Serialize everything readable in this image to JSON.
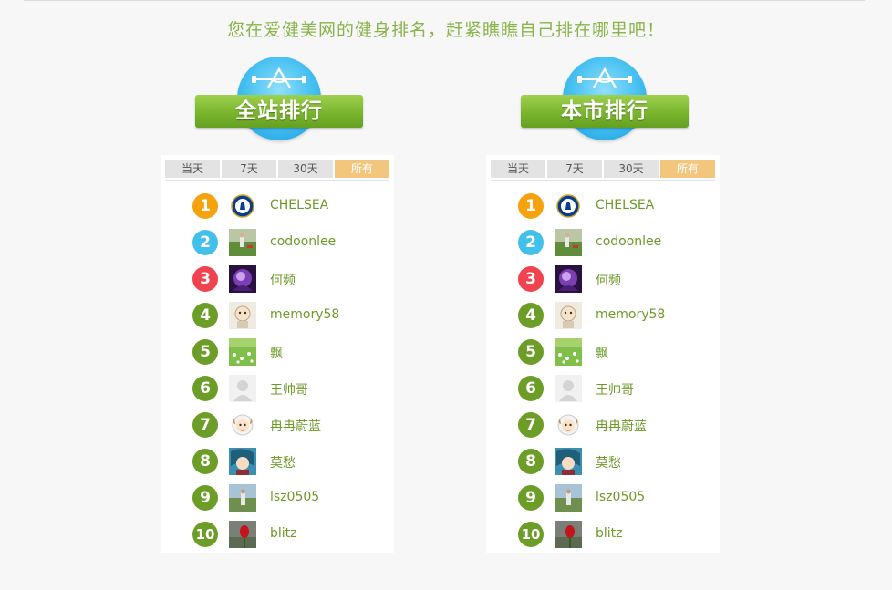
{
  "headline": "您在爱健美网的健身排名，赶紧瞧瞧自己排在哪里吧！",
  "colors": {
    "rank1": "#f5a20c",
    "rank2": "#42c0ec",
    "rank3": "#f0434f",
    "rank_default": "#6c9d27",
    "username": "#6f9a2a",
    "headline": "#8ab44a",
    "tab_active": "#f2c77d"
  },
  "panels": [
    {
      "id": "site",
      "title": "全站排行",
      "tabs": [
        {
          "label": "当天",
          "active": false
        },
        {
          "label": "7天",
          "active": false
        },
        {
          "label": "30天",
          "active": false
        },
        {
          "label": "所有",
          "active": true
        }
      ],
      "ranks": [
        {
          "rank": "1",
          "name": "CHELSEA",
          "avatar": "chelsea-crest-icon"
        },
        {
          "rank": "2",
          "name": "codoonlee",
          "avatar": "field-photo"
        },
        {
          "rank": "3",
          "name": "何频",
          "avatar": "purple-art-photo"
        },
        {
          "rank": "4",
          "name": "memory58",
          "avatar": "cartoon-character-photo"
        },
        {
          "rank": "5",
          "name": "飘",
          "avatar": "green-flowers-photo"
        },
        {
          "rank": "6",
          "name": "王帅哥",
          "avatar": "default-user-icon"
        },
        {
          "rank": "7",
          "name": "冉冉蔚蓝",
          "avatar": "sheep-cartoon-photo"
        },
        {
          "rank": "8",
          "name": "莫愁",
          "avatar": "anime-character-photo"
        },
        {
          "rank": "9",
          "name": "lsz0505",
          "avatar": "person-outdoor-photo"
        },
        {
          "rank": "10",
          "name": "blitz",
          "avatar": "red-flower-photo"
        }
      ]
    },
    {
      "id": "city",
      "title": "本市排行",
      "tabs": [
        {
          "label": "当天",
          "active": false
        },
        {
          "label": "7天",
          "active": false
        },
        {
          "label": "30天",
          "active": false
        },
        {
          "label": "所有",
          "active": true
        }
      ],
      "ranks": [
        {
          "rank": "1",
          "name": "CHELSEA",
          "avatar": "chelsea-crest-icon"
        },
        {
          "rank": "2",
          "name": "codoonlee",
          "avatar": "field-photo"
        },
        {
          "rank": "3",
          "name": "何频",
          "avatar": "purple-art-photo"
        },
        {
          "rank": "4",
          "name": "memory58",
          "avatar": "cartoon-character-photo"
        },
        {
          "rank": "5",
          "name": "飘",
          "avatar": "green-flowers-photo"
        },
        {
          "rank": "6",
          "name": "王帅哥",
          "avatar": "default-user-icon"
        },
        {
          "rank": "7",
          "name": "冉冉蔚蓝",
          "avatar": "sheep-cartoon-photo"
        },
        {
          "rank": "8",
          "name": "莫愁",
          "avatar": "anime-character-photo"
        },
        {
          "rank": "9",
          "name": "lsz0505",
          "avatar": "person-outdoor-photo"
        },
        {
          "rank": "10",
          "name": "blitz",
          "avatar": "red-flower-photo"
        }
      ]
    }
  ]
}
